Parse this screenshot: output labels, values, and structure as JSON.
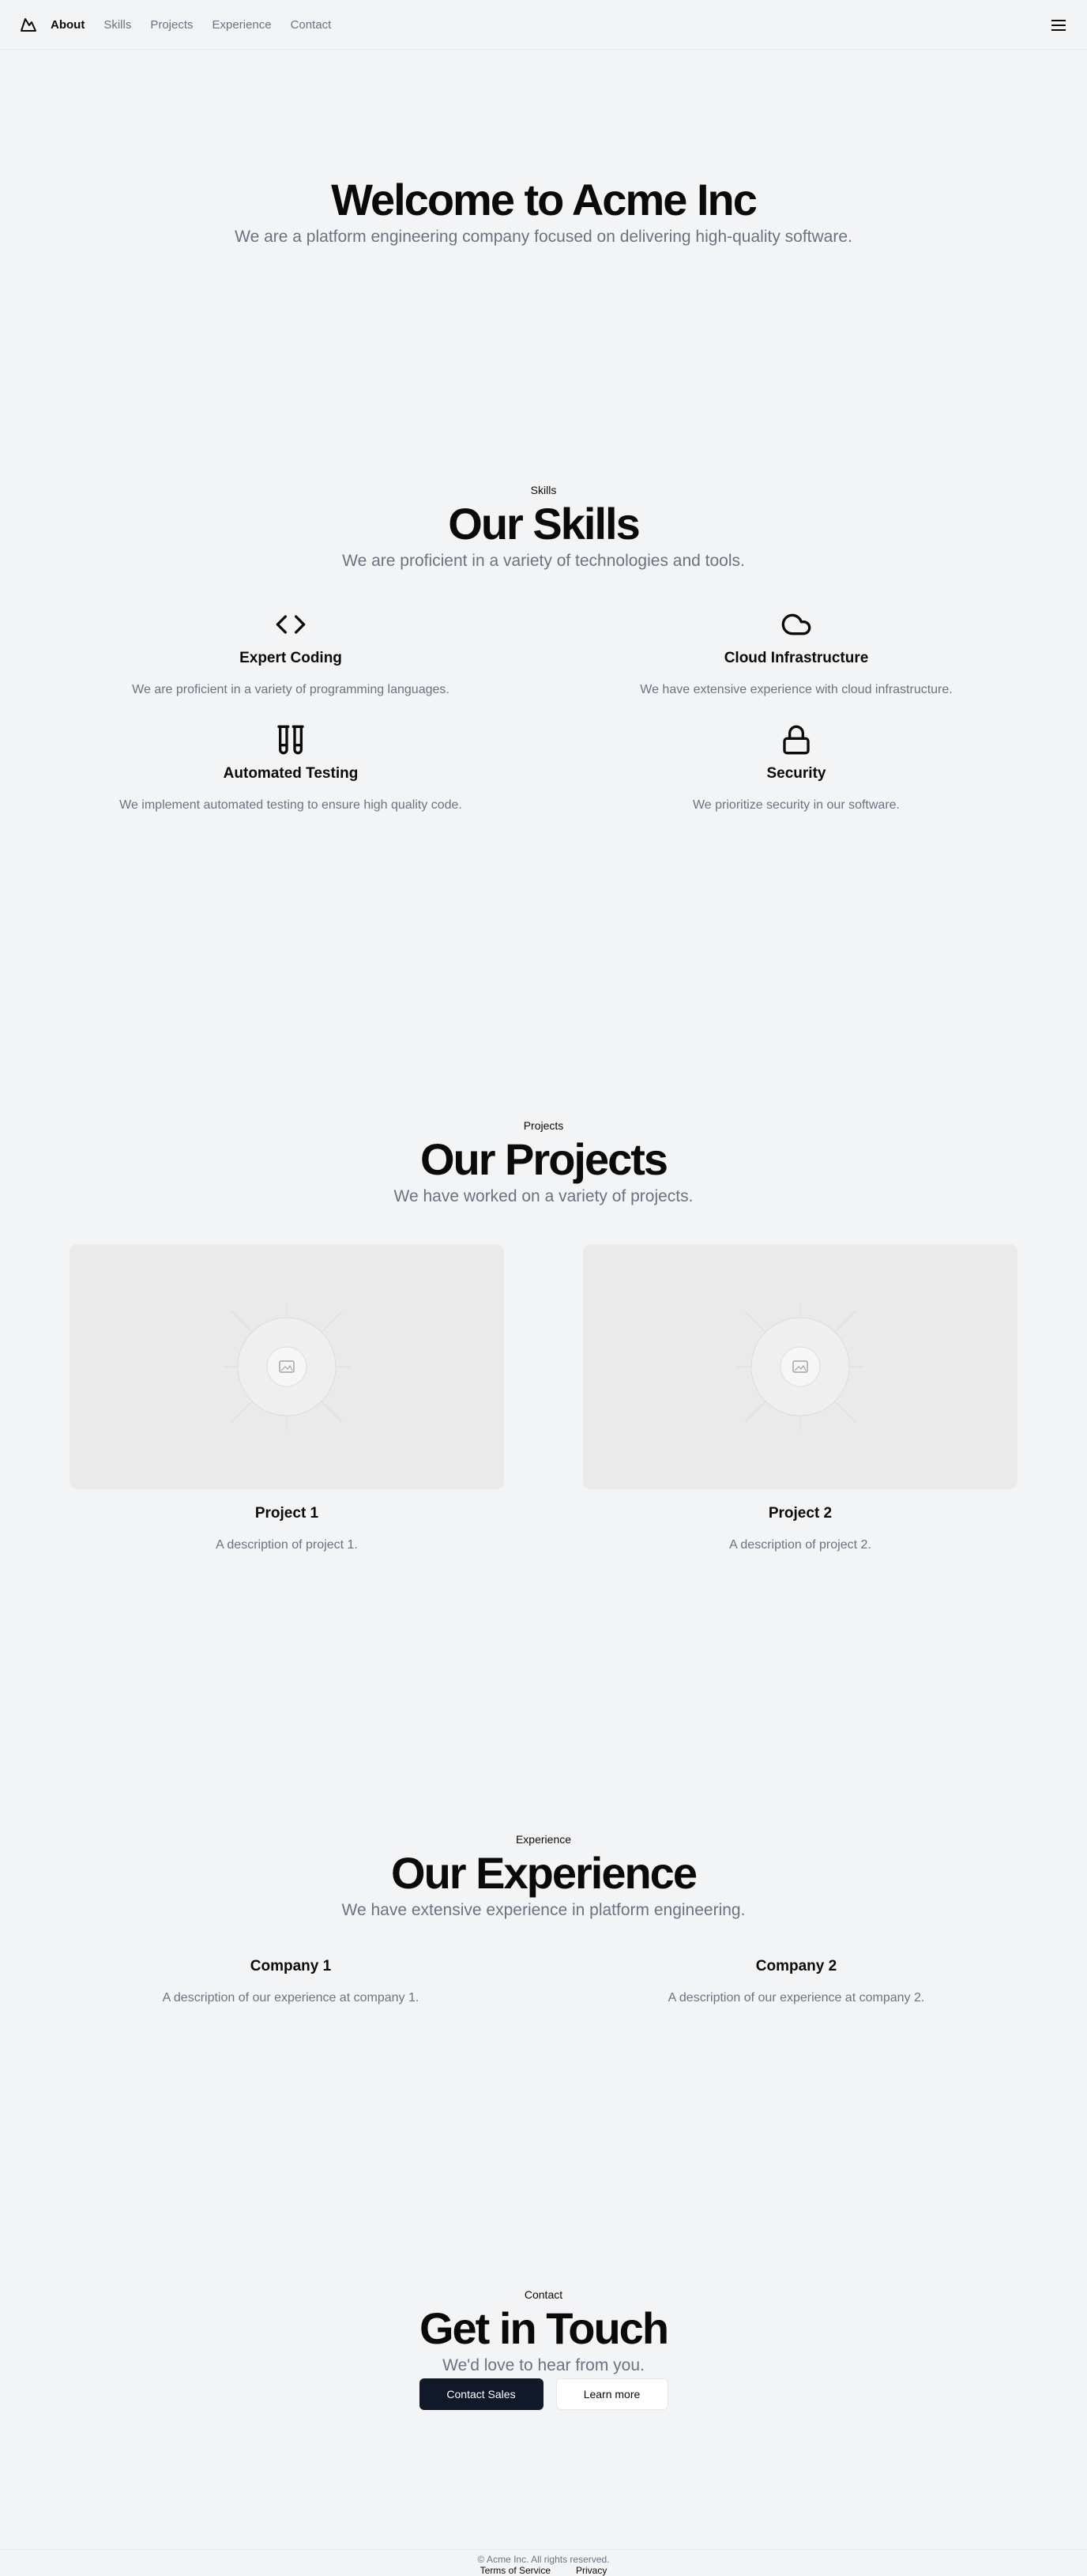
{
  "nav": {
    "items": [
      {
        "label": "About",
        "active": true
      },
      {
        "label": "Skills",
        "active": false
      },
      {
        "label": "Projects",
        "active": false
      },
      {
        "label": "Experience",
        "active": false
      },
      {
        "label": "Contact",
        "active": false
      }
    ],
    "logo_icon": "mountain-icon",
    "menu_icon": "menu-icon"
  },
  "hero": {
    "title": "Welcome to Acme Inc",
    "subtitle": "We are a platform engineering company focused on delivering high-quality software."
  },
  "skills": {
    "eyebrow": "Skills",
    "title": "Our Skills",
    "subtitle": "We are proficient in a variety of technologies and tools.",
    "items": [
      {
        "icon": "code-icon",
        "title": "Expert Coding",
        "text": "We are proficient in a variety of programming languages."
      },
      {
        "icon": "cloud-icon",
        "title": "Cloud Infrastructure",
        "text": "We have extensive experience with cloud infrastructure."
      },
      {
        "icon": "test-tubes-icon",
        "title": "Automated Testing",
        "text": "We implement automated testing to ensure high quality code."
      },
      {
        "icon": "lock-icon",
        "title": "Security",
        "text": "We prioritize security in our software."
      }
    ]
  },
  "projects": {
    "eyebrow": "Projects",
    "title": "Our Projects",
    "subtitle": "We have worked on a variety of projects.",
    "items": [
      {
        "title": "Project 1",
        "text": "A description of project 1."
      },
      {
        "title": "Project 2",
        "text": "A description of project 2."
      }
    ]
  },
  "experience": {
    "eyebrow": "Experience",
    "title": "Our Experience",
    "subtitle": "We have extensive experience in platform engineering.",
    "items": [
      {
        "title": "Company 1",
        "text": "A description of our experience at company 1."
      },
      {
        "title": "Company 2",
        "text": "A description of our experience at company 2."
      }
    ]
  },
  "contact": {
    "eyebrow": "Contact",
    "title": "Get in Touch",
    "subtitle": "We'd love to hear from you.",
    "primary_button": "Contact Sales",
    "secondary_button": "Learn more"
  },
  "footer": {
    "copyright": "© Acme Inc. All rights reserved.",
    "links": [
      "Terms of Service",
      "Privacy"
    ]
  },
  "colors": {
    "background": "#f3f4f6",
    "text": "#0a0a0a",
    "muted": "#6b7280",
    "primary_button": "#111827"
  }
}
